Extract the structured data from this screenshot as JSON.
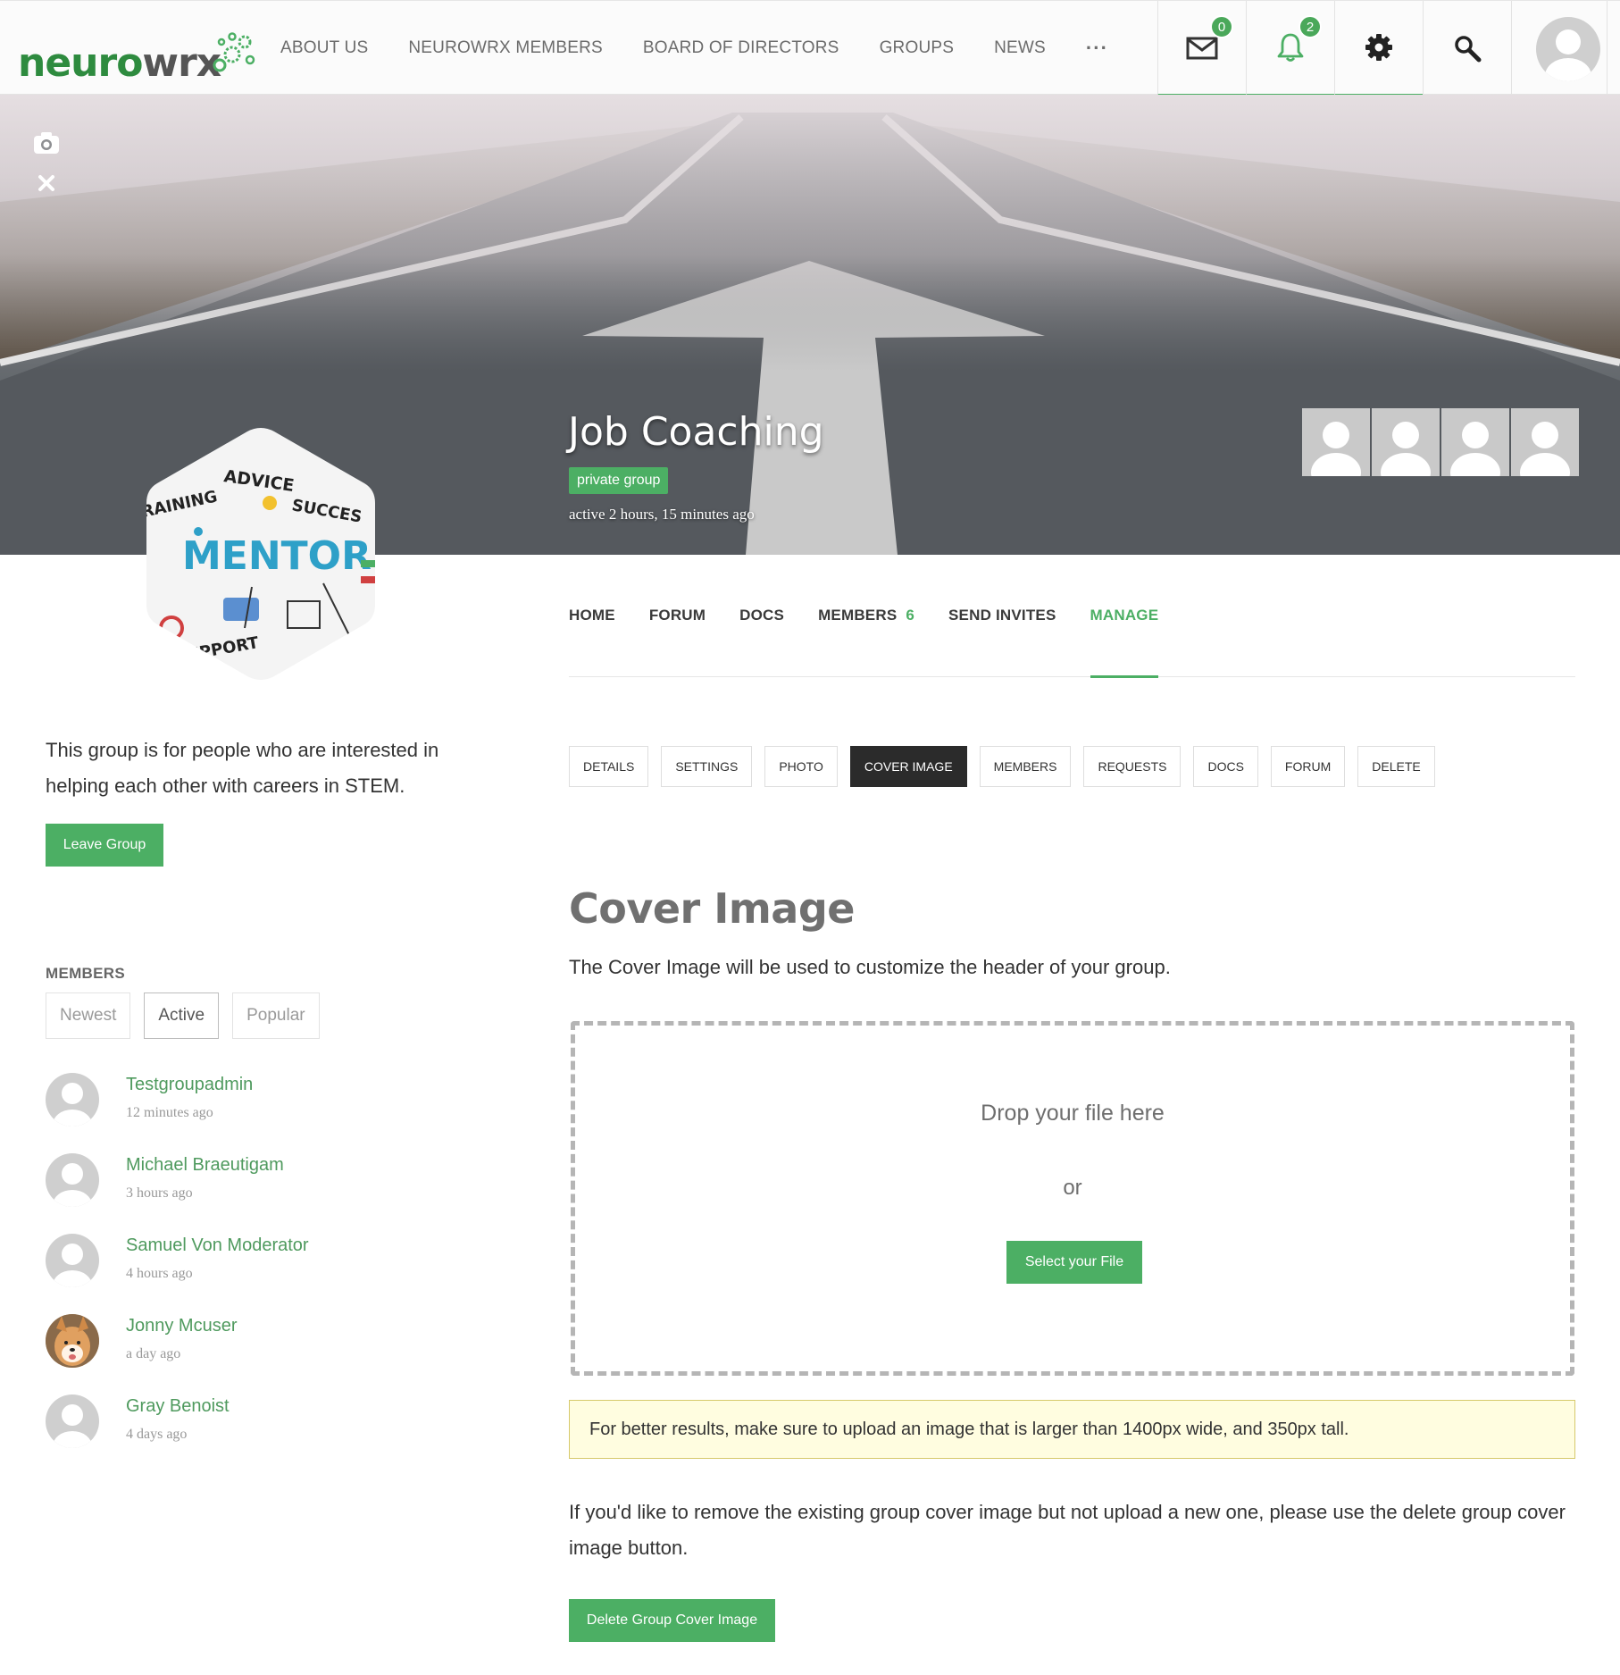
{
  "header": {
    "logo_primary": "neuro",
    "logo_secondary": "wrx",
    "nav": [
      "ABOUT US",
      "NEUROWRX MEMBERS",
      "BOARD OF DIRECTORS",
      "GROUPS",
      "NEWS"
    ],
    "nav_more": "···",
    "messages_count": "0",
    "notifications_count": "2"
  },
  "cover": {
    "group_name": "Job Coaching",
    "privacy_badge": "private group",
    "activity": "active 2 hours, 15 minutes ago"
  },
  "group_tabs": [
    {
      "label": "HOME"
    },
    {
      "label": "FORUM"
    },
    {
      "label": "DOCS"
    },
    {
      "label": "MEMBERS",
      "count": "6"
    },
    {
      "label": "SEND INVITES"
    },
    {
      "label": "MANAGE"
    }
  ],
  "manage_tabs": [
    "DETAILS",
    "SETTINGS",
    "PHOTO",
    "COVER IMAGE",
    "MEMBERS",
    "REQUESTS",
    "DOCS",
    "FORUM",
    "DELETE"
  ],
  "sidebar": {
    "description": "This group is for people who are interested in helping each other with careers in STEM.",
    "leave_button": "Leave Group",
    "members_heading": "MEMBERS",
    "filters": [
      "Newest",
      "Active",
      "Popular"
    ],
    "members": [
      {
        "name": "Testgroupadmin",
        "time": "12 minutes ago"
      },
      {
        "name": "Michael Braeutigam",
        "time": "3 hours ago"
      },
      {
        "name": "Samuel Von Moderator",
        "time": "4 hours ago"
      },
      {
        "name": "Jonny Mcuser",
        "time": "a day ago"
      },
      {
        "name": "Gray Benoist",
        "time": "4 days ago"
      }
    ]
  },
  "main": {
    "heading": "Cover Image",
    "intro": "The Cover Image will be used to customize the header of your group.",
    "drop_text": "Drop your file here",
    "or_text": "or",
    "select_button": "Select your File",
    "notice": "For better results, make sure to upload an image that is larger than 1400px wide, and 350px tall.",
    "remove_info": "If you'd like to remove the existing group cover image but not upload a new one, please use the delete group cover image button.",
    "delete_button": "Delete Group Cover Image"
  },
  "avatar_image_text": [
    "ADVICE",
    "RAINING",
    "SUCCES",
    "MENTORING",
    "UPPORT"
  ],
  "colors": {
    "brand_green": "#4caf64",
    "dark_tab": "#2b2b2b",
    "notice_bg": "#fffde0"
  }
}
